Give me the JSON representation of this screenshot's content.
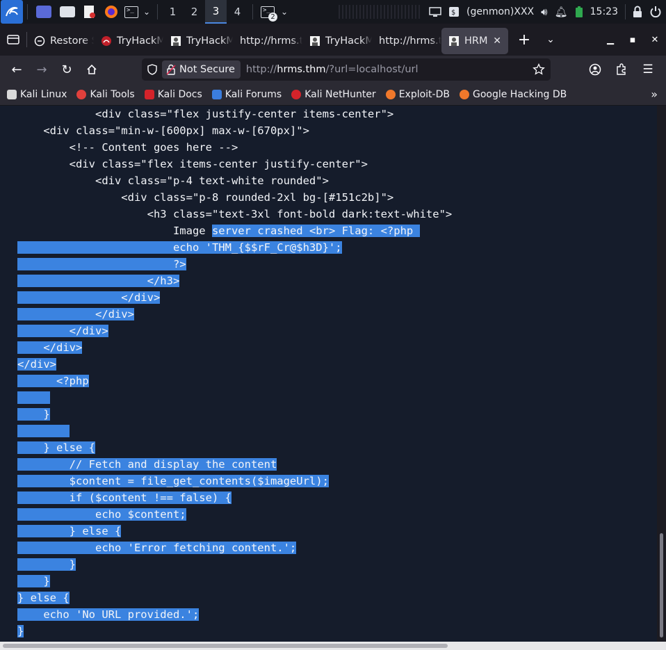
{
  "taskbar": {
    "workspaces": [
      "1",
      "2",
      "3",
      "4"
    ],
    "active_workspace": "3",
    "terminal_badge": "2",
    "genmon_text": "(genmon)XXX",
    "clock": "15:23"
  },
  "tabs": [
    {
      "label": "Restore S",
      "icon": "restore-icon",
      "active": false
    },
    {
      "label": "TryHackM",
      "icon": "tryhackme-icon",
      "active": false
    },
    {
      "label": "TryHackM",
      "icon": "tryhackme-icon",
      "active": false
    },
    {
      "label": "http://hrms.t",
      "icon": "",
      "active": false
    },
    {
      "label": "TryHackM",
      "icon": "tryhackme-icon",
      "active": false
    },
    {
      "label": "http://hrms.t",
      "icon": "",
      "active": false
    },
    {
      "label": "HRMS",
      "icon": "hrms-icon",
      "active": true
    }
  ],
  "nav": {
    "not_secure_label": "Not Secure",
    "url_prefix": "http://",
    "url_host": "hrms.thm",
    "url_rest": "/?url=localhost/url"
  },
  "bookmarks": [
    {
      "label": "Kali Linux",
      "color": "#d9d9d9"
    },
    {
      "label": "Kali Tools",
      "color": "#e0403c"
    },
    {
      "label": "Kali Docs",
      "color": "#d4232a"
    },
    {
      "label": "Kali Forums",
      "color": "#3b7ddd"
    },
    {
      "label": "Kali NetHunter",
      "color": "#d4232a"
    },
    {
      "label": "Exploit-DB",
      "color": "#f0782b"
    },
    {
      "label": "Google Hacking DB",
      "color": "#f0782b"
    }
  ],
  "code_lines": [
    {
      "pre": "            <div class=\"flex justify-center items-center\">",
      "sel": ""
    },
    {
      "pre": "    <div class=\"min-w-[600px] max-w-[670px]\">",
      "sel": ""
    },
    {
      "pre": "        <!-- Content goes here -->",
      "sel": ""
    },
    {
      "pre": "        <div class=\"flex items-center justify-center\">",
      "sel": ""
    },
    {
      "pre": "            <div class=\"p-4 text-white rounded\">",
      "sel": ""
    },
    {
      "pre": "                <div class=\"p-8 rounded-2xl bg-[#151c2b]\">",
      "sel": ""
    },
    {
      "pre": "                    <h3 class=\"text-3xl font-bold dark:text-white\">",
      "sel": ""
    },
    {
      "pre": "                        Image ",
      "sel": "server crashed <br> Flag: <?php "
    },
    {
      "pre": "",
      "sel": "                        echo 'THM_{$$rF_Cr@$h3D}';"
    },
    {
      "pre": "",
      "sel": "                        ?>"
    },
    {
      "pre": "",
      "sel": "                    </h3>"
    },
    {
      "pre": "",
      "sel": "                </div>"
    },
    {
      "pre": "",
      "sel": "            </div>"
    },
    {
      "pre": "",
      "sel": "        </div>"
    },
    {
      "pre": "",
      "sel": "    </div>"
    },
    {
      "pre": "",
      "sel": "</div>"
    },
    {
      "pre": "",
      "sel": "      <?php"
    },
    {
      "pre": "",
      "sel": "     "
    },
    {
      "pre": "",
      "sel": "    }"
    },
    {
      "pre": "",
      "sel": "        "
    },
    {
      "pre": "",
      "sel": "    } else {"
    },
    {
      "pre": "",
      "sel": "        // Fetch and display the content"
    },
    {
      "pre": "",
      "sel": "        $content = file_get_contents($imageUrl);"
    },
    {
      "pre": "",
      "sel": "        if ($content !== false) {"
    },
    {
      "pre": "",
      "sel": "            echo $content;"
    },
    {
      "pre": "",
      "sel": "        } else {"
    },
    {
      "pre": "",
      "sel": "            echo 'Error fetching content.';"
    },
    {
      "pre": "",
      "sel": "        }"
    },
    {
      "pre": "",
      "sel": "    }"
    },
    {
      "pre": "",
      "sel": "} else {"
    },
    {
      "pre": "",
      "sel": "    echo 'No URL provided.';"
    },
    {
      "pre": "",
      "sel": "}"
    }
  ]
}
